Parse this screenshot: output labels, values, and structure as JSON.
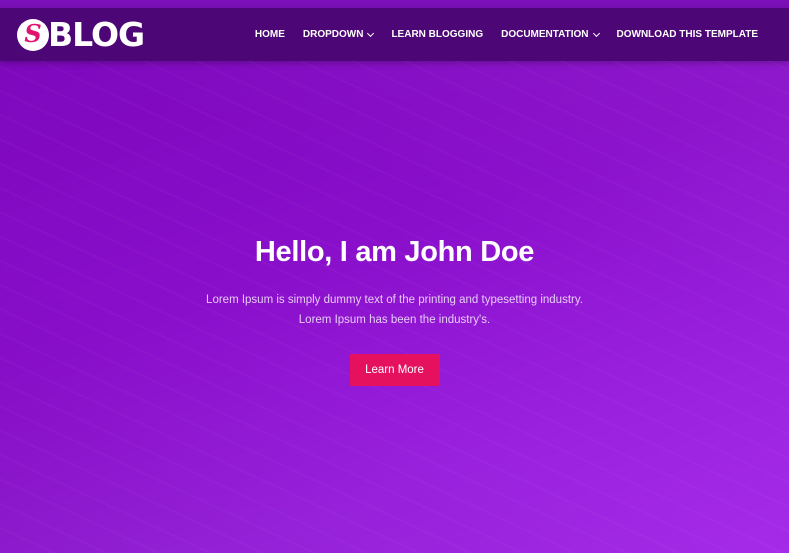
{
  "header": {
    "logo_letter": "S",
    "logo_text": "BLOG",
    "nav": [
      {
        "label": "HOME",
        "has_dropdown": false
      },
      {
        "label": "DROPDOWN",
        "has_dropdown": true
      },
      {
        "label": "LEARN BLOGGING",
        "has_dropdown": false
      },
      {
        "label": "DOCUMENTATION",
        "has_dropdown": true
      },
      {
        "label": "DOWNLOAD THIS TEMPLATE",
        "has_dropdown": false
      }
    ]
  },
  "hero": {
    "title": "Hello, I am John Doe",
    "text": "Lorem Ipsum is simply dummy text of the printing and typesetting industry. Lorem Ipsum has been the industry's.",
    "button_label": "Learn More"
  },
  "colors": {
    "header_bg": "#4c0675",
    "hero_gradient_start": "#7a07b9",
    "hero_gradient_end": "#a52be8",
    "button_bg": "#e5115f",
    "logo_accent": "#e0146e"
  },
  "icons": {
    "dropdown": "chevron-down-icon",
    "logo": "logo-s-icon"
  }
}
